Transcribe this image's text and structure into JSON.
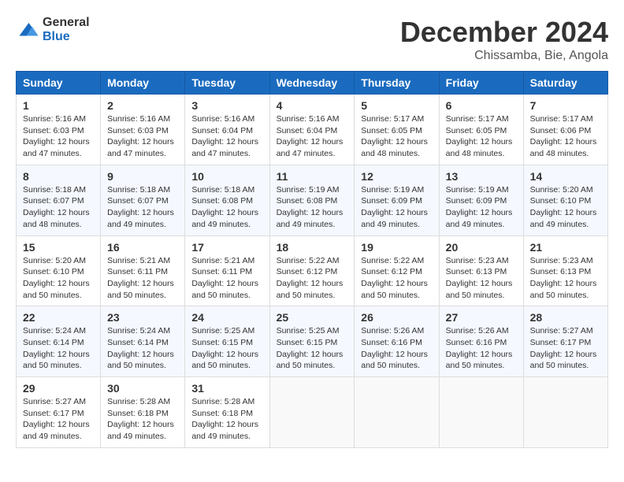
{
  "logo": {
    "general": "General",
    "blue": "Blue"
  },
  "header": {
    "month": "December 2024",
    "location": "Chissamba, Bie, Angola"
  },
  "weekdays": [
    "Sunday",
    "Monday",
    "Tuesday",
    "Wednesday",
    "Thursday",
    "Friday",
    "Saturday"
  ],
  "weeks": [
    [
      {
        "day": "1",
        "sunrise": "5:16 AM",
        "sunset": "6:03 PM",
        "daylight": "12 hours and 47 minutes."
      },
      {
        "day": "2",
        "sunrise": "5:16 AM",
        "sunset": "6:03 PM",
        "daylight": "12 hours and 47 minutes."
      },
      {
        "day": "3",
        "sunrise": "5:16 AM",
        "sunset": "6:04 PM",
        "daylight": "12 hours and 47 minutes."
      },
      {
        "day": "4",
        "sunrise": "5:16 AM",
        "sunset": "6:04 PM",
        "daylight": "12 hours and 47 minutes."
      },
      {
        "day": "5",
        "sunrise": "5:17 AM",
        "sunset": "6:05 PM",
        "daylight": "12 hours and 48 minutes."
      },
      {
        "day": "6",
        "sunrise": "5:17 AM",
        "sunset": "6:05 PM",
        "daylight": "12 hours and 48 minutes."
      },
      {
        "day": "7",
        "sunrise": "5:17 AM",
        "sunset": "6:06 PM",
        "daylight": "12 hours and 48 minutes."
      }
    ],
    [
      {
        "day": "8",
        "sunrise": "5:18 AM",
        "sunset": "6:07 PM",
        "daylight": "12 hours and 48 minutes."
      },
      {
        "day": "9",
        "sunrise": "5:18 AM",
        "sunset": "6:07 PM",
        "daylight": "12 hours and 49 minutes."
      },
      {
        "day": "10",
        "sunrise": "5:18 AM",
        "sunset": "6:08 PM",
        "daylight": "12 hours and 49 minutes."
      },
      {
        "day": "11",
        "sunrise": "5:19 AM",
        "sunset": "6:08 PM",
        "daylight": "12 hours and 49 minutes."
      },
      {
        "day": "12",
        "sunrise": "5:19 AM",
        "sunset": "6:09 PM",
        "daylight": "12 hours and 49 minutes."
      },
      {
        "day": "13",
        "sunrise": "5:19 AM",
        "sunset": "6:09 PM",
        "daylight": "12 hours and 49 minutes."
      },
      {
        "day": "14",
        "sunrise": "5:20 AM",
        "sunset": "6:10 PM",
        "daylight": "12 hours and 49 minutes."
      }
    ],
    [
      {
        "day": "15",
        "sunrise": "5:20 AM",
        "sunset": "6:10 PM",
        "daylight": "12 hours and 50 minutes."
      },
      {
        "day": "16",
        "sunrise": "5:21 AM",
        "sunset": "6:11 PM",
        "daylight": "12 hours and 50 minutes."
      },
      {
        "day": "17",
        "sunrise": "5:21 AM",
        "sunset": "6:11 PM",
        "daylight": "12 hours and 50 minutes."
      },
      {
        "day": "18",
        "sunrise": "5:22 AM",
        "sunset": "6:12 PM",
        "daylight": "12 hours and 50 minutes."
      },
      {
        "day": "19",
        "sunrise": "5:22 AM",
        "sunset": "6:12 PM",
        "daylight": "12 hours and 50 minutes."
      },
      {
        "day": "20",
        "sunrise": "5:23 AM",
        "sunset": "6:13 PM",
        "daylight": "12 hours and 50 minutes."
      },
      {
        "day": "21",
        "sunrise": "5:23 AM",
        "sunset": "6:13 PM",
        "daylight": "12 hours and 50 minutes."
      }
    ],
    [
      {
        "day": "22",
        "sunrise": "5:24 AM",
        "sunset": "6:14 PM",
        "daylight": "12 hours and 50 minutes."
      },
      {
        "day": "23",
        "sunrise": "5:24 AM",
        "sunset": "6:14 PM",
        "daylight": "12 hours and 50 minutes."
      },
      {
        "day": "24",
        "sunrise": "5:25 AM",
        "sunset": "6:15 PM",
        "daylight": "12 hours and 50 minutes."
      },
      {
        "day": "25",
        "sunrise": "5:25 AM",
        "sunset": "6:15 PM",
        "daylight": "12 hours and 50 minutes."
      },
      {
        "day": "26",
        "sunrise": "5:26 AM",
        "sunset": "6:16 PM",
        "daylight": "12 hours and 50 minutes."
      },
      {
        "day": "27",
        "sunrise": "5:26 AM",
        "sunset": "6:16 PM",
        "daylight": "12 hours and 50 minutes."
      },
      {
        "day": "28",
        "sunrise": "5:27 AM",
        "sunset": "6:17 PM",
        "daylight": "12 hours and 50 minutes."
      }
    ],
    [
      {
        "day": "29",
        "sunrise": "5:27 AM",
        "sunset": "6:17 PM",
        "daylight": "12 hours and 49 minutes."
      },
      {
        "day": "30",
        "sunrise": "5:28 AM",
        "sunset": "6:18 PM",
        "daylight": "12 hours and 49 minutes."
      },
      {
        "day": "31",
        "sunrise": "5:28 AM",
        "sunset": "6:18 PM",
        "daylight": "12 hours and 49 minutes."
      },
      null,
      null,
      null,
      null
    ]
  ],
  "labels": {
    "sunrise": "Sunrise:",
    "sunset": "Sunset:",
    "daylight": "Daylight:"
  }
}
